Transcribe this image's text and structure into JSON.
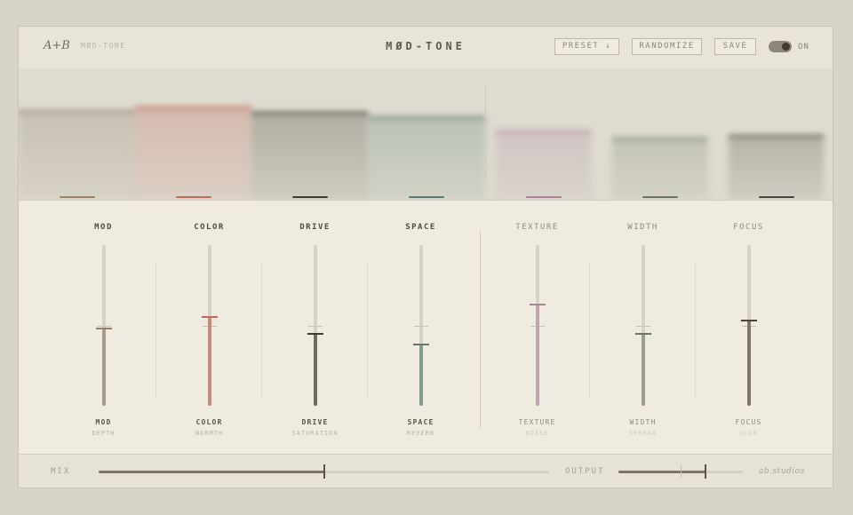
{
  "header": {
    "logo": "A+B",
    "brand": "MØD-TONE",
    "title": "MØD-TONE",
    "preset_label": "PRESET ↓",
    "randomize_label": "RANDOMIZE",
    "save_label": "SAVE",
    "power_state": "ON"
  },
  "controls": [
    {
      "id": "mod",
      "top_label": "MOD",
      "label": "MOD",
      "sublabel": "DEPTH",
      "value": 0.48,
      "color": "#a89a88",
      "handle_color": "#9a7f6a",
      "style": "bold"
    },
    {
      "id": "color",
      "top_label": "COLOR",
      "label": "COLOR",
      "sublabel": "WARMTH",
      "value": 0.55,
      "color": "#c8887a",
      "handle_color": "#c06a58",
      "style": "bold"
    },
    {
      "id": "drive",
      "top_label": "DRIVE",
      "label": "DRIVE",
      "sublabel": "SATURATION",
      "value": 0.45,
      "color": "#6e6a62",
      "handle_color": "#3e3a34",
      "style": "bold"
    },
    {
      "id": "space",
      "top_label": "SPACE",
      "label": "SPACE",
      "sublabel": "REVERB",
      "value": 0.38,
      "color": "#849c90",
      "handle_color": "#5f7a6e",
      "style": "bold"
    },
    {
      "id": "texture",
      "top_label": "TEXTURE",
      "label": "TEXTURE",
      "sublabel": "NOISE",
      "value": 0.63,
      "color": "#bfa6b0",
      "handle_color": "#a7868f",
      "style": "light"
    },
    {
      "id": "width",
      "top_label": "WIDTH",
      "label": "WIDTH",
      "sublabel": "SPREAD",
      "value": 0.45,
      "color": "#9aa08e",
      "handle_color": "#6e7464",
      "style": "light"
    },
    {
      "id": "focus",
      "top_label": "FOCUS",
      "label": "FOCUS",
      "sublabel": "GLUE",
      "value": 0.53,
      "color": "#7c766c",
      "handle_color": "#4a463f",
      "style": "light"
    }
  ],
  "footer": {
    "mix_label": "MIX",
    "mix_value": 0.5,
    "output_label": "OUTPUT",
    "output_value": 0.7,
    "signature": "ab.studios"
  },
  "colors": {
    "background": "#d8d4c8",
    "panel": "#efebe0",
    "accent_warm": "#c8887a",
    "accent_cool": "#849c90"
  }
}
